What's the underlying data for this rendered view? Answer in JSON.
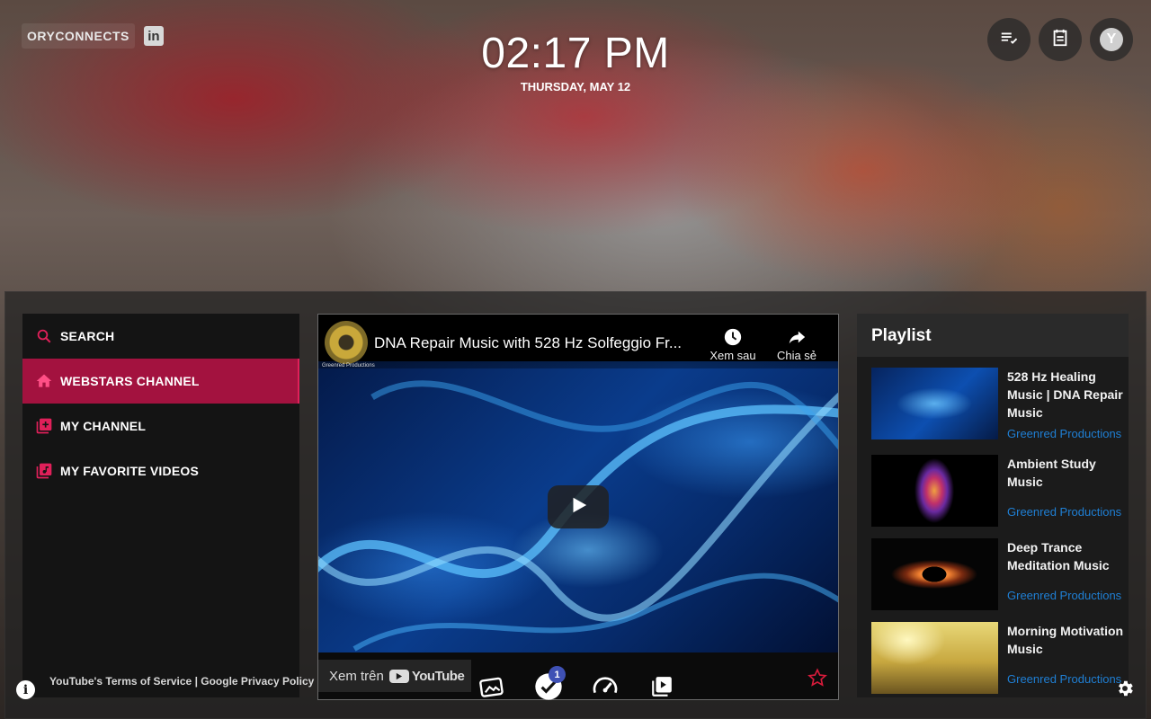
{
  "brand": {
    "logo_text": "ORYCONNECTS",
    "linkedin_label": "in"
  },
  "clock": {
    "time": "02:17 PM",
    "date": "THURSDAY, MAY 12"
  },
  "top_actions": {
    "avatar_letter": "Y"
  },
  "sidebar": {
    "items": [
      {
        "label": "SEARCH",
        "icon": "search-icon",
        "active": false
      },
      {
        "label": "WEBSTARS CHANNEL",
        "icon": "home-icon",
        "active": true
      },
      {
        "label": "MY CHANNEL",
        "icon": "library-add-icon",
        "active": false
      },
      {
        "label": "MY FAVORITE VIDEOS",
        "icon": "library-music-icon",
        "active": false
      }
    ]
  },
  "video": {
    "title": "DNA Repair Music with 528 Hz Solfeggio Fr...",
    "channel_tag": "Greenred Productions",
    "watch_later_label": "Xem sau",
    "share_label": "Chia sẻ",
    "watch_on_label": "Xem trên",
    "youtube_label": "YouTube"
  },
  "playlist": {
    "heading": "Playlist",
    "items": [
      {
        "title": "528 Hz Healing Music | DNA Repair Music",
        "channel": "Greenred Productions"
      },
      {
        "title": "Ambient Study Music",
        "channel": "Greenred Productions"
      },
      {
        "title": "Deep Trance Meditation Music",
        "channel": "Greenred Productions"
      },
      {
        "title": "Morning Motivation Music",
        "channel": "Greenred Productions"
      }
    ]
  },
  "footer": {
    "links": "YouTube's Terms of Service | Google Privacy Policy",
    "info_label": "i",
    "tasks_badge": "1"
  },
  "colors": {
    "accent": "#a3123f",
    "accent_bright": "#e0205a",
    "link": "#1f7fd4",
    "badge": "#3f51b5"
  }
}
